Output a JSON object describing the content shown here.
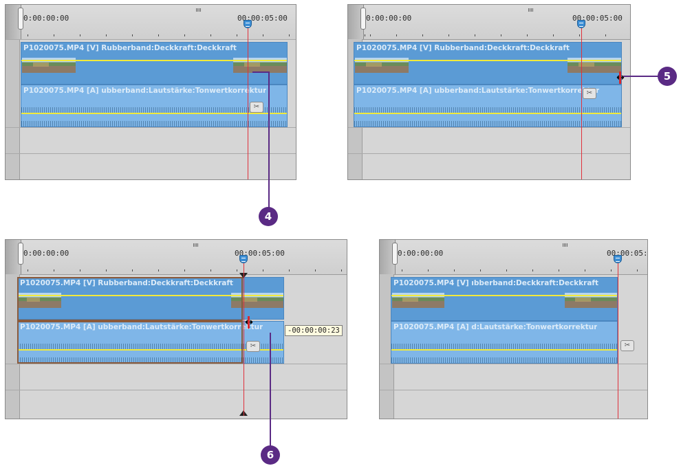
{
  "panels": {
    "p1": {
      "tc_start": "0:00:00:00",
      "tc_end": "00:00:05:00",
      "video_label": "P1020075.MP4 [V] Rubberband:Deckkraft:Deckkraft",
      "audio_label": "P1020075.MP4 [A] ubberband:Lautstärke:Tonwertkorrektur"
    },
    "p2": {
      "tc_start": "0:00:00:00",
      "tc_end": "00:00:05:00",
      "video_label": "P1020075.MP4 [V] Rubberband:Deckkraft:Deckkraft",
      "audio_label": "P1020075.MP4 [A] ubberband:Lautstärke:Tonwertkorrektur"
    },
    "p3": {
      "tc_start": "0:00:00:00",
      "tc_end": "00:00:05:00",
      "video_label": "P1020075.MP4 [V] Rubberband:Deckkraft:Deckkraft",
      "audio_label": "P1020075.MP4 [A] ubberband:Lautstärke:Tonwertkorrektur",
      "tooltip": "-00:00:00:23"
    },
    "p4": {
      "tc_start": "0:00:00:00",
      "tc_end": "00:00:05:",
      "video_label": "P1020075.MP4 [V] ıbberband:Deckkraft:Deckkraft",
      "audio_label": "P1020075.MP4 [A] d:Lautstärke:Tonwertkorrektur"
    }
  },
  "callouts": {
    "c4": "4",
    "c5": "5",
    "c6": "6"
  },
  "colors": {
    "clip_blue": "#5b9bd5",
    "rubberband": "#f2ea3a",
    "playhead": "#e0303a",
    "callout": "#5a2a84"
  }
}
